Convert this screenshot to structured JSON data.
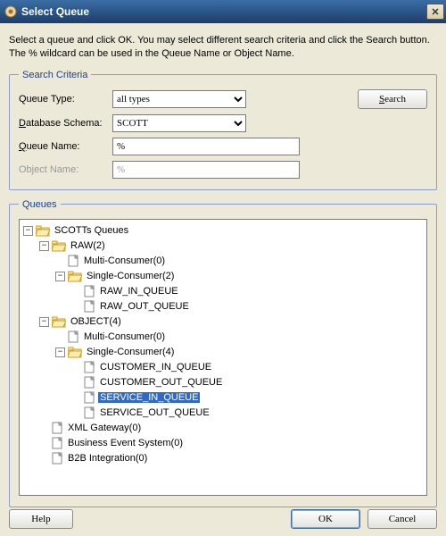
{
  "window": {
    "title": "Select Queue",
    "close_glyph": "✕"
  },
  "instructions": "Select a queue and click OK. You may select different search criteria and click the Search button. The % wildcard can be used in the Queue Name or Object Name.",
  "criteria": {
    "legend": "Search Criteria",
    "queue_type_label": "Queue Type:",
    "queue_type_value": "all types",
    "db_schema_label": "Database Schema:",
    "db_schema_value": "SCOTT",
    "queue_name_label": "Queue Name:",
    "queue_name_value": "%",
    "object_name_label": "Object Name:",
    "object_name_value": "%",
    "search_label": "Search"
  },
  "queues": {
    "legend": "Queues",
    "root": "SCOTTs Queues",
    "raw": {
      "label": "RAW(2)",
      "multi": "Multi-Consumer(0)",
      "single": "Single-Consumer(2)",
      "items": [
        "RAW_IN_QUEUE",
        "RAW_OUT_QUEUE"
      ]
    },
    "object": {
      "label": "OBJECT(4)",
      "multi": "Multi-Consumer(0)",
      "single": "Single-Consumer(4)",
      "items": [
        "CUSTOMER_IN_QUEUE",
        "CUSTOMER_OUT_QUEUE",
        "SERVICE_IN_QUEUE",
        "SERVICE_OUT_QUEUE"
      ]
    },
    "xml_gateway": "XML Gateway(0)",
    "bes": "Business Event System(0)",
    "b2b": "B2B Integration(0)"
  },
  "buttons": {
    "help": "Help",
    "ok": "OK",
    "cancel": "Cancel"
  },
  "selected_queue": "SERVICE_IN_QUEUE"
}
